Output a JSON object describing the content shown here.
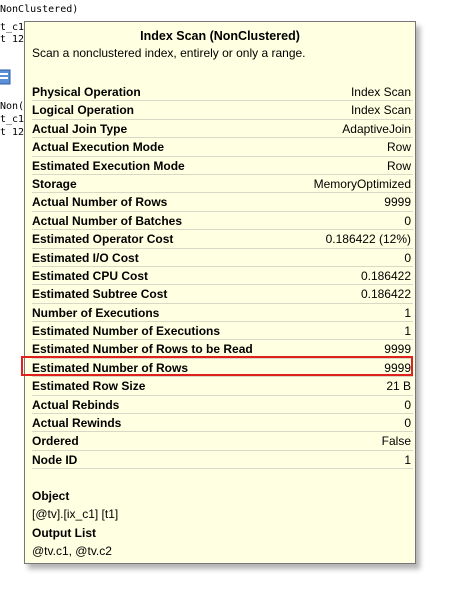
{
  "plan_background": {
    "fragments": [
      "NonClustered)",
      "t_c1",
      "t 12",
      "Non(",
      "t_c1",
      "t 12"
    ],
    "icon": "index-scan-icon"
  },
  "tooltip": {
    "title": "Index Scan (NonClustered)",
    "description": "Scan a nonclustered index, entirely or only a range.",
    "properties": [
      {
        "label": "Physical Operation",
        "value": "Index Scan"
      },
      {
        "label": "Logical Operation",
        "value": "Index Scan"
      },
      {
        "label": "Actual Join Type",
        "value": "AdaptiveJoin"
      },
      {
        "label": "Actual Execution Mode",
        "value": "Row"
      },
      {
        "label": "Estimated Execution Mode",
        "value": "Row"
      },
      {
        "label": "Storage",
        "value": "MemoryOptimized"
      },
      {
        "label": "Actual Number of Rows",
        "value": "9999"
      },
      {
        "label": "Actual Number of Batches",
        "value": "0"
      },
      {
        "label": "Estimated Operator Cost",
        "value": "0.186422 (12%)"
      },
      {
        "label": "Estimated I/O Cost",
        "value": "0"
      },
      {
        "label": "Estimated CPU Cost",
        "value": "0.186422"
      },
      {
        "label": "Estimated Subtree Cost",
        "value": "0.186422"
      },
      {
        "label": "Number of Executions",
        "value": "1"
      },
      {
        "label": "Estimated Number of Executions",
        "value": "1"
      },
      {
        "label": "Estimated Number of Rows to be Read",
        "value": "9999"
      },
      {
        "label": "Estimated Number of Rows",
        "value": "9999"
      },
      {
        "label": "Estimated Row Size",
        "value": "21 B"
      },
      {
        "label": "Actual Rebinds",
        "value": "0"
      },
      {
        "label": "Actual Rewinds",
        "value": "0"
      },
      {
        "label": "Ordered",
        "value": "False"
      },
      {
        "label": "Node ID",
        "value": "1"
      }
    ],
    "highlighted_property": "Estimated Number of Rows",
    "object_heading": "Object",
    "object_value": "[@tv].[ix_c1] [t1]",
    "output_heading": "Output List",
    "output_value": "@tv.c1, @tv.c2",
    "highlight_color": "#e0201c",
    "background_color": "#ffffe1"
  }
}
